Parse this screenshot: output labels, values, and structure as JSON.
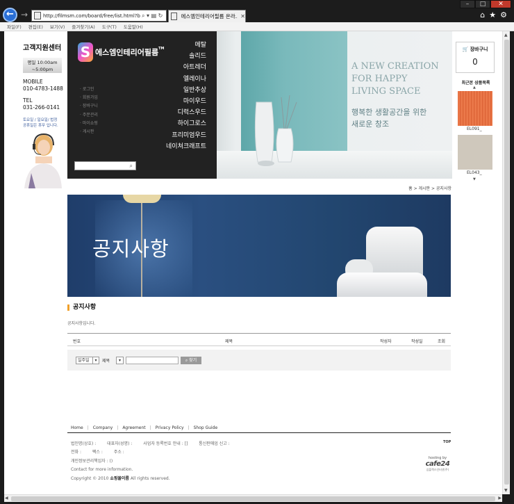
{
  "browser": {
    "address": "http://filmsm.com/board/free/list.html?boar",
    "tab_title": "에스엠인테리어필름 온라...",
    "menu": [
      "파일(F)",
      "편집(E)",
      "보기(V)",
      "즐겨찾기(A)",
      "도구(T)",
      "도움말(H)"
    ]
  },
  "customer_center": {
    "title": "고객지원센터",
    "hours_line1": "평일 10:00am",
    "hours_line2": "~5:00pm",
    "mobile_label": "MOBILE",
    "mobile": "010-4783-1488",
    "tel_label": "TEL",
    "tel": "031-266-0141",
    "note_line1": "토요일 / 일요일/ 법정",
    "note_line2": "공휴일은 휴무 입니다."
  },
  "header": {
    "logo_text": "에스엠인테리어필름",
    "logo_tm": "TM",
    "categories": [
      "메탈",
      "솔리드",
      "아트레더",
      "엘레이나",
      "일반추상",
      "마이우드",
      "디럭스우드",
      "하이그로스",
      "프리미엄우드",
      "네이쳐크래프트"
    ],
    "mini_links": [
      "로그인",
      "회원가입",
      "장바구니",
      "주문관리",
      "마이쇼핑",
      "게시판"
    ]
  },
  "hero": {
    "line1": "A NEW CREATION",
    "line2": "FOR HAPPY",
    "line3": "LIVING SPACE",
    "sub1": "행복한 생활공간을 위한",
    "sub2": "새로운 창조"
  },
  "sidebar": {
    "cart_label": "장바구니",
    "cart_count": "0",
    "recent_label": "최근본 상품목록",
    "products": [
      {
        "name": "EL091_"
      },
      {
        "name": "EL043_"
      }
    ]
  },
  "breadcrumb": "홈 > 게시판 > 공지사항",
  "banner_title": "공지사항",
  "board": {
    "title": "공지사항",
    "description": "공지사항입니다.",
    "columns": {
      "no": "번호",
      "subject": "제목",
      "writer": "작성자",
      "date": "작성일",
      "views": "조회"
    },
    "period_select": "일주일",
    "field_select": "제목",
    "find_button": "찾기"
  },
  "footer": {
    "nav": [
      "Home",
      "Company",
      "Agreement",
      "Privacy Policy",
      "Shop Guide"
    ],
    "line1a": "법인명(상호) :",
    "line1b": "대표자(성명) :",
    "line1c": "사업자 등록번호 안내 : []",
    "line1d": "통신판매업 신고 :",
    "line2a": "전화 :",
    "line2b": "팩스 :",
    "line2c": "주소 :",
    "line3": "개인정보관리책임자 : ()",
    "line4": "Contact for more information.",
    "copyright_pre": "Copyright © 2010",
    "copyright_brand": "쇼핑몰이름",
    "copyright_post": "All rights reserved.",
    "top": "TOP",
    "hosting_label": "hosting by",
    "hosting_brand": "cafe24",
    "hosting_sub": "심플렉스인터넷(주)"
  }
}
